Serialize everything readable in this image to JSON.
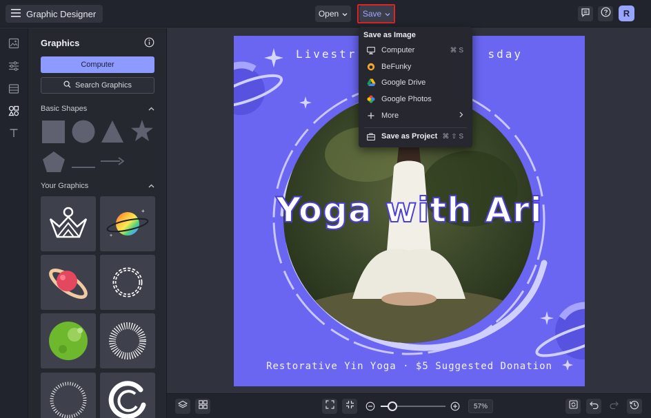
{
  "app": {
    "title": "Graphic Designer"
  },
  "toolbar": {
    "open_label": "Open",
    "save_label": "Save",
    "highlight_color": "#e02424"
  },
  "panel": {
    "title": "Graphics",
    "computer_label": "Computer",
    "search_label": "Search Graphics",
    "basic_shapes_label": "Basic Shapes",
    "your_graphics_label": "Your Graphics"
  },
  "canvas": {
    "top_text": "Livestr",
    "top_text_right": "sday",
    "headline": "Yoga with Ari",
    "bottom_text": "Restorative Yin Yoga · $5 Suggested Donation",
    "background_color": "#6a66f2"
  },
  "zoom": {
    "value": "57%",
    "level": 0.57
  },
  "save_menu": {
    "title": "Save as Image",
    "items": [
      {
        "label": "Computer",
        "shortcut": "⌘ S",
        "icon": "monitor-icon"
      },
      {
        "label": "BeFunky",
        "shortcut": "",
        "icon": "befunky-icon"
      },
      {
        "label": "Google Drive",
        "shortcut": "",
        "icon": "google-drive-icon"
      },
      {
        "label": "Google Photos",
        "shortcut": "",
        "icon": "google-photos-icon"
      },
      {
        "label": "More",
        "shortcut": "",
        "icon": "plus-icon"
      }
    ],
    "project": {
      "label": "Save as Project",
      "shortcut": "⌘ ⇧ S",
      "icon": "briefcase-icon"
    }
  },
  "user": {
    "avatar_initial": "R"
  }
}
